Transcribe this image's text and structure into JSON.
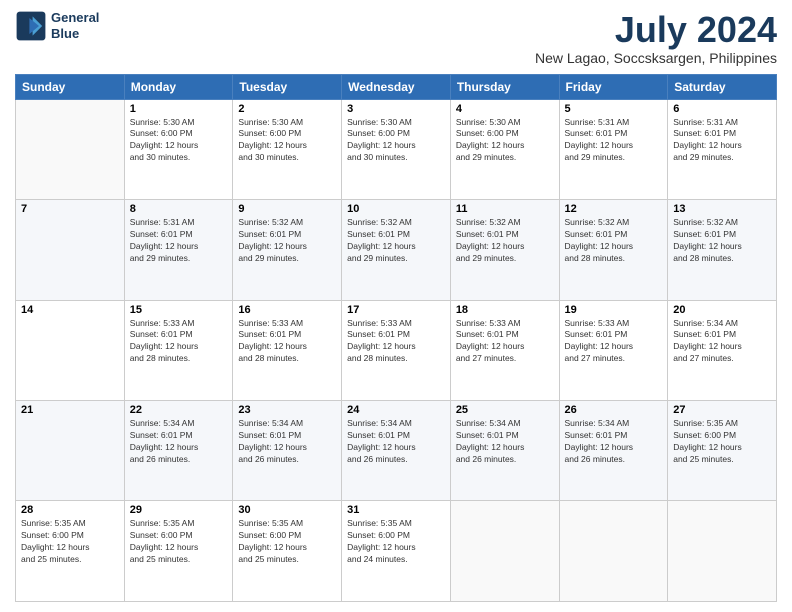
{
  "header": {
    "logo_line1": "General",
    "logo_line2": "Blue",
    "title": "July 2024",
    "subtitle": "New Lagao, Soccsksargen, Philippines"
  },
  "weekdays": [
    "Sunday",
    "Monday",
    "Tuesday",
    "Wednesday",
    "Thursday",
    "Friday",
    "Saturday"
  ],
  "weeks": [
    [
      {
        "day": "",
        "info": ""
      },
      {
        "day": "1",
        "info": "Sunrise: 5:30 AM\nSunset: 6:00 PM\nDaylight: 12 hours\nand 30 minutes."
      },
      {
        "day": "2",
        "info": "Sunrise: 5:30 AM\nSunset: 6:00 PM\nDaylight: 12 hours\nand 30 minutes."
      },
      {
        "day": "3",
        "info": "Sunrise: 5:30 AM\nSunset: 6:00 PM\nDaylight: 12 hours\nand 30 minutes."
      },
      {
        "day": "4",
        "info": "Sunrise: 5:30 AM\nSunset: 6:00 PM\nDaylight: 12 hours\nand 29 minutes."
      },
      {
        "day": "5",
        "info": "Sunrise: 5:31 AM\nSunset: 6:01 PM\nDaylight: 12 hours\nand 29 minutes."
      },
      {
        "day": "6",
        "info": "Sunrise: 5:31 AM\nSunset: 6:01 PM\nDaylight: 12 hours\nand 29 minutes."
      }
    ],
    [
      {
        "day": "7",
        "info": ""
      },
      {
        "day": "8",
        "info": "Sunrise: 5:31 AM\nSunset: 6:01 PM\nDaylight: 12 hours\nand 29 minutes."
      },
      {
        "day": "9",
        "info": "Sunrise: 5:32 AM\nSunset: 6:01 PM\nDaylight: 12 hours\nand 29 minutes."
      },
      {
        "day": "10",
        "info": "Sunrise: 5:32 AM\nSunset: 6:01 PM\nDaylight: 12 hours\nand 29 minutes."
      },
      {
        "day": "11",
        "info": "Sunrise: 5:32 AM\nSunset: 6:01 PM\nDaylight: 12 hours\nand 29 minutes."
      },
      {
        "day": "12",
        "info": "Sunrise: 5:32 AM\nSunset: 6:01 PM\nDaylight: 12 hours\nand 28 minutes."
      },
      {
        "day": "13",
        "info": "Sunrise: 5:32 AM\nSunset: 6:01 PM\nDaylight: 12 hours\nand 28 minutes."
      }
    ],
    [
      {
        "day": "14",
        "info": ""
      },
      {
        "day": "15",
        "info": "Sunrise: 5:33 AM\nSunset: 6:01 PM\nDaylight: 12 hours\nand 28 minutes."
      },
      {
        "day": "16",
        "info": "Sunrise: 5:33 AM\nSunset: 6:01 PM\nDaylight: 12 hours\nand 28 minutes."
      },
      {
        "day": "17",
        "info": "Sunrise: 5:33 AM\nSunset: 6:01 PM\nDaylight: 12 hours\nand 28 minutes."
      },
      {
        "day": "18",
        "info": "Sunrise: 5:33 AM\nSunset: 6:01 PM\nDaylight: 12 hours\nand 27 minutes."
      },
      {
        "day": "19",
        "info": "Sunrise: 5:33 AM\nSunset: 6:01 PM\nDaylight: 12 hours\nand 27 minutes."
      },
      {
        "day": "20",
        "info": "Sunrise: 5:34 AM\nSunset: 6:01 PM\nDaylight: 12 hours\nand 27 minutes."
      }
    ],
    [
      {
        "day": "21",
        "info": ""
      },
      {
        "day": "22",
        "info": "Sunrise: 5:34 AM\nSunset: 6:01 PM\nDaylight: 12 hours\nand 26 minutes."
      },
      {
        "day": "23",
        "info": "Sunrise: 5:34 AM\nSunset: 6:01 PM\nDaylight: 12 hours\nand 26 minutes."
      },
      {
        "day": "24",
        "info": "Sunrise: 5:34 AM\nSunset: 6:01 PM\nDaylight: 12 hours\nand 26 minutes."
      },
      {
        "day": "25",
        "info": "Sunrise: 5:34 AM\nSunset: 6:01 PM\nDaylight: 12 hours\nand 26 minutes."
      },
      {
        "day": "26",
        "info": "Sunrise: 5:34 AM\nSunset: 6:01 PM\nDaylight: 12 hours\nand 26 minutes."
      },
      {
        "day": "27",
        "info": "Sunrise: 5:35 AM\nSunset: 6:00 PM\nDaylight: 12 hours\nand 25 minutes."
      }
    ],
    [
      {
        "day": "28",
        "info": "Sunrise: 5:35 AM\nSunset: 6:00 PM\nDaylight: 12 hours\nand 25 minutes."
      },
      {
        "day": "29",
        "info": "Sunrise: 5:35 AM\nSunset: 6:00 PM\nDaylight: 12 hours\nand 25 minutes."
      },
      {
        "day": "30",
        "info": "Sunrise: 5:35 AM\nSunset: 6:00 PM\nDaylight: 12 hours\nand 25 minutes."
      },
      {
        "day": "31",
        "info": "Sunrise: 5:35 AM\nSunset: 6:00 PM\nDaylight: 12 hours\nand 24 minutes."
      },
      {
        "day": "",
        "info": ""
      },
      {
        "day": "",
        "info": ""
      },
      {
        "day": "",
        "info": ""
      }
    ]
  ]
}
